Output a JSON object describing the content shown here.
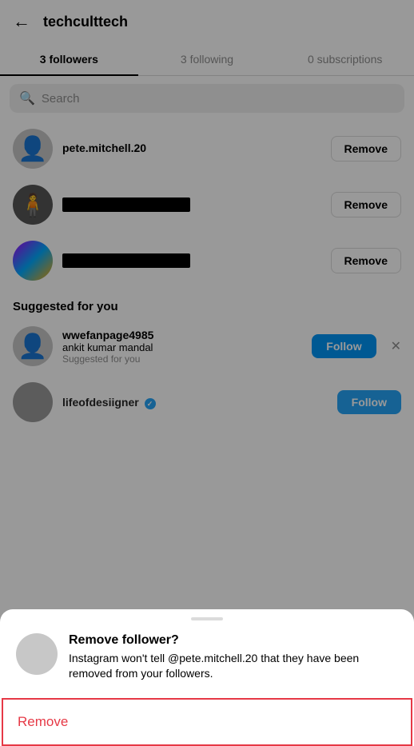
{
  "header": {
    "back_label": "←",
    "title": "techculttech"
  },
  "tabs": [
    {
      "label": "3 followers",
      "active": true
    },
    {
      "label": "3 following",
      "active": false
    },
    {
      "label": "0 subscriptions",
      "active": false
    }
  ],
  "search": {
    "placeholder": "Search"
  },
  "followers": [
    {
      "username": "pete.mitchell.20",
      "redacted": false
    },
    {
      "username": "",
      "redacted": true
    },
    {
      "username": "",
      "redacted": true
    }
  ],
  "remove_label": "Remove",
  "suggested_title": "Suggested for you",
  "suggested": [
    {
      "name": "wwefanpage4985",
      "subname": "ankit kumar mandal",
      "label": "Suggested for you",
      "follow_label": "Follow",
      "verified": false
    },
    {
      "name": "lifeofdesiigner",
      "subname": "",
      "label": "",
      "follow_label": "Follow",
      "verified": true
    }
  ],
  "bottom_sheet": {
    "title": "Remove follower?",
    "description": "Instagram won't tell @pete.mitchell.20 that they have been removed from your followers.",
    "remove_label": "Remove"
  }
}
